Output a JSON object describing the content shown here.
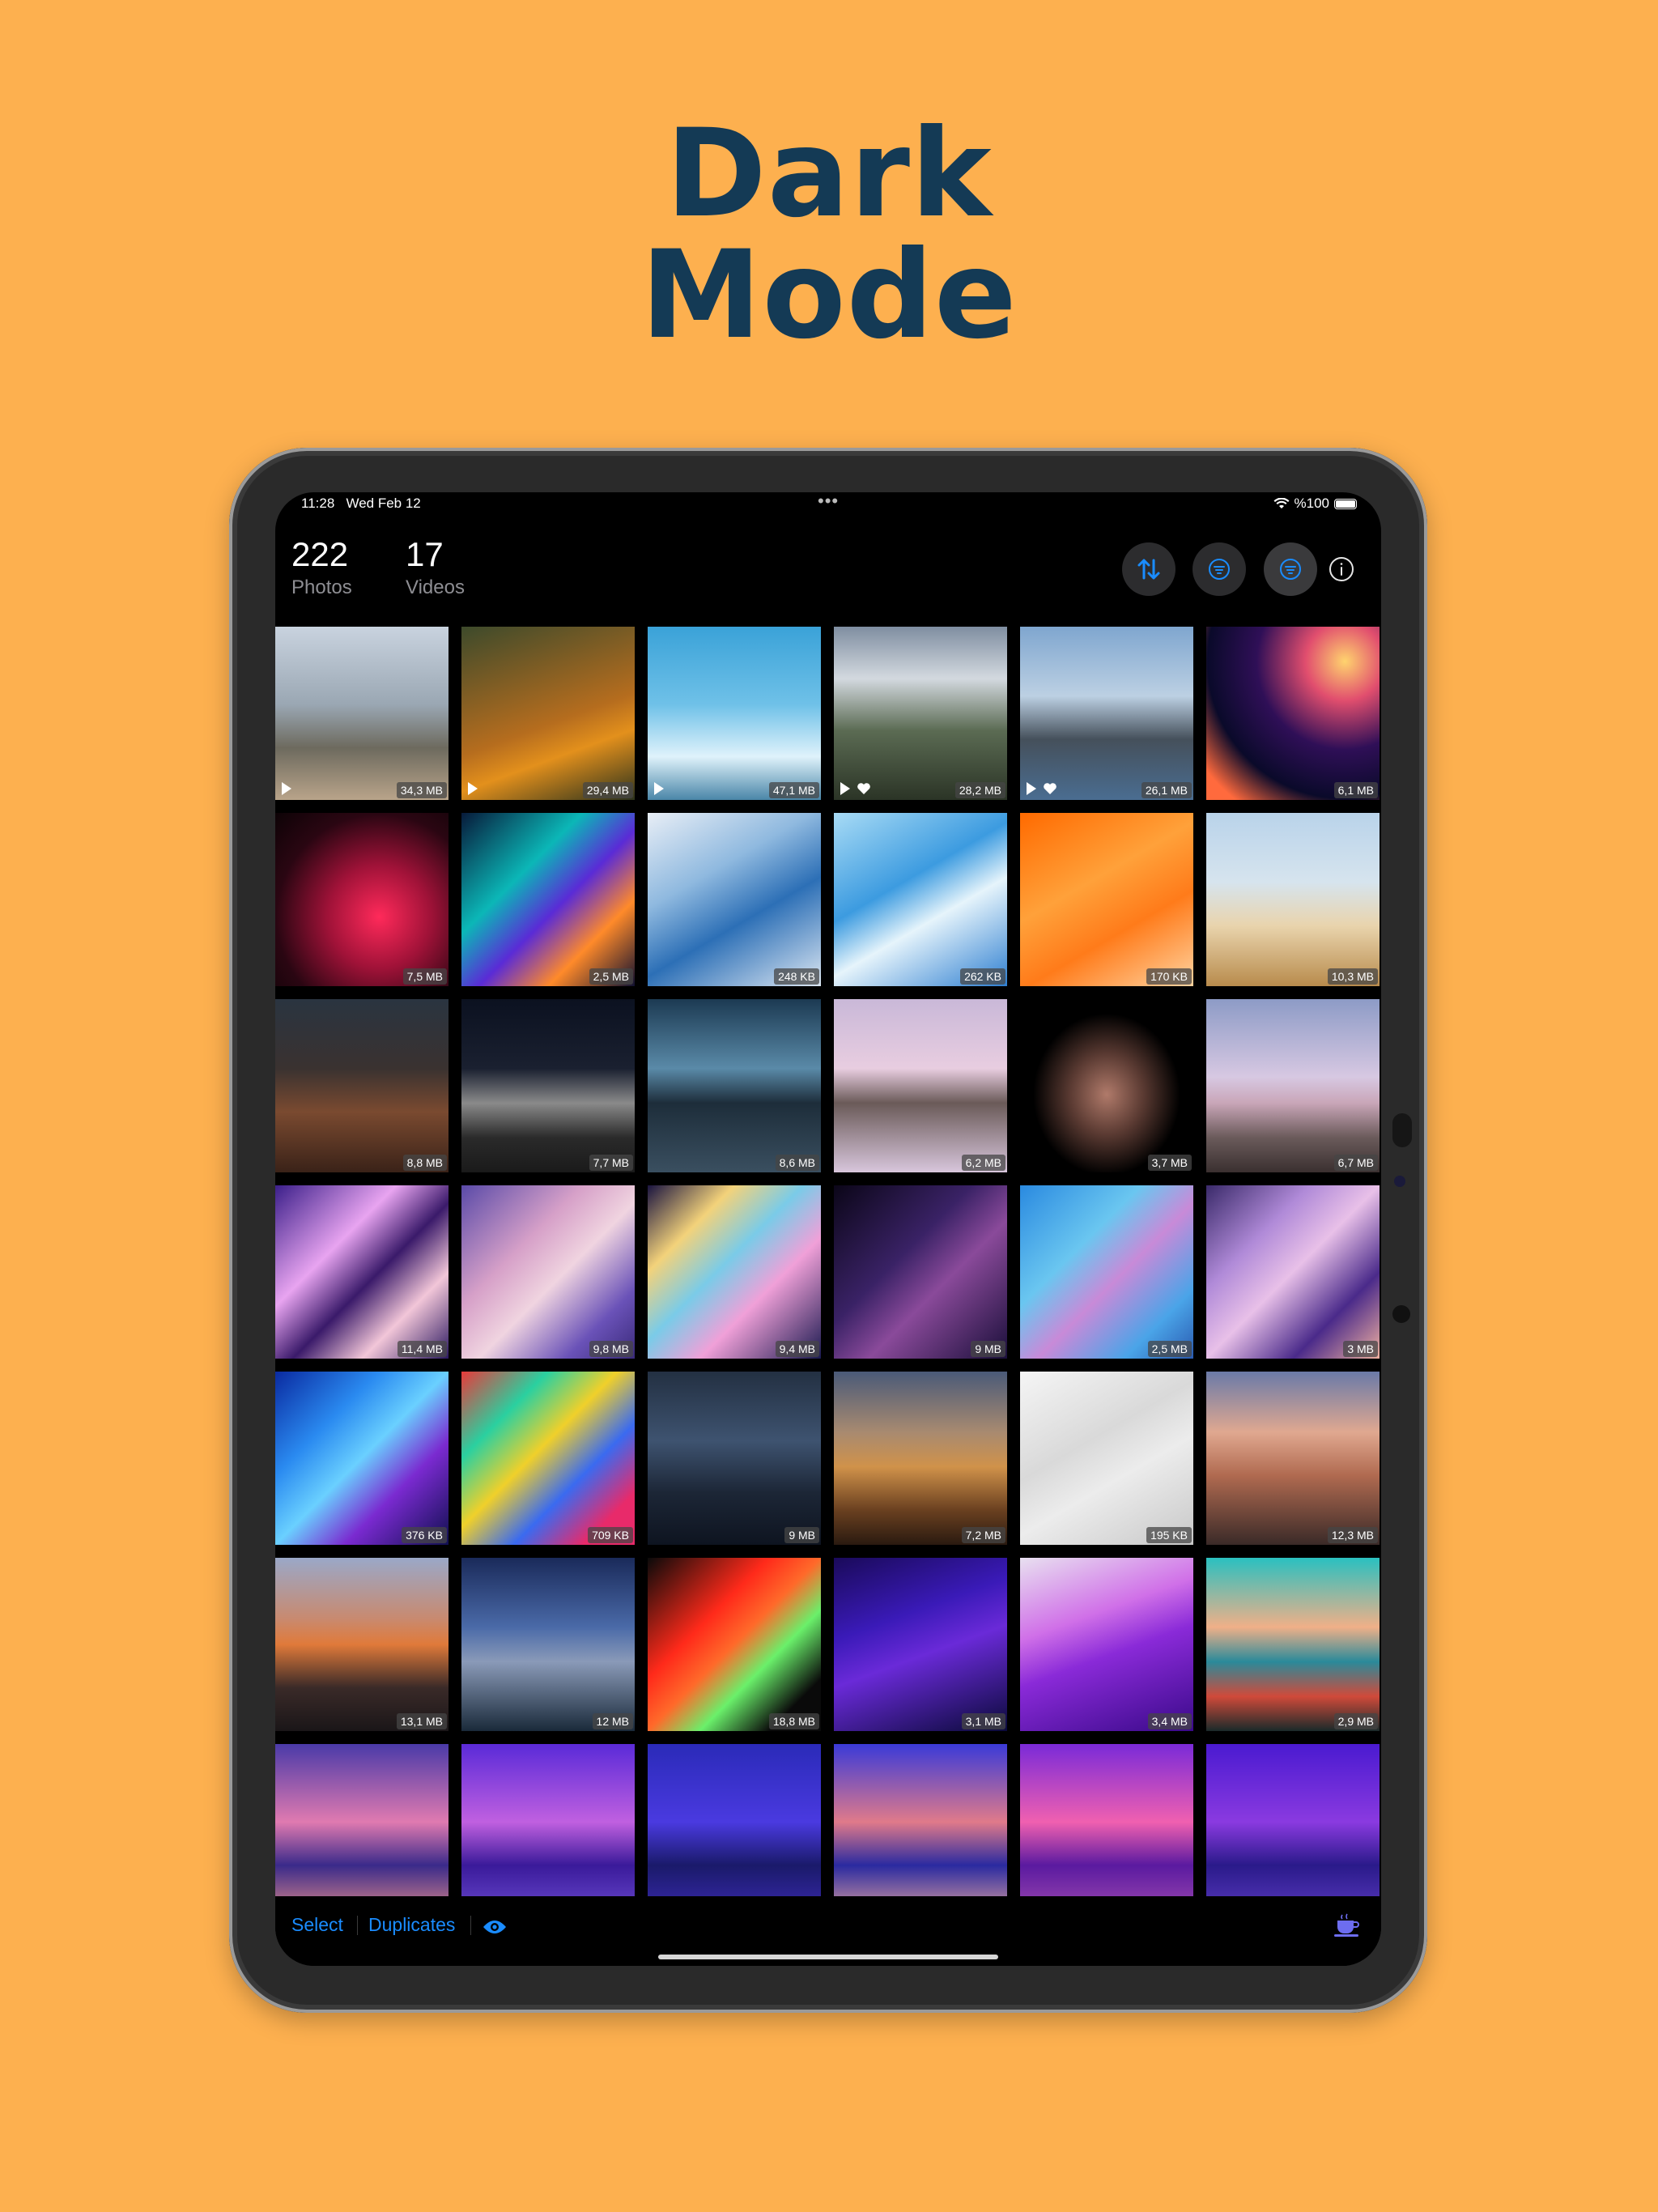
{
  "headline": {
    "line1": "Dark",
    "line2": "Mode"
  },
  "status": {
    "time": "11:28",
    "date": "Wed Feb 12",
    "battery": "%100"
  },
  "header": {
    "photos_count": "222",
    "photos_label": "Photos",
    "videos_count": "17",
    "videos_label": "Videos"
  },
  "grid": {
    "rows": [
      [
        {
          "size": "34,3 MB",
          "video": true,
          "favorite": false
        },
        {
          "size": "29,4 MB",
          "video": true,
          "favorite": false
        },
        {
          "size": "47,1 MB",
          "video": true,
          "favorite": false
        },
        {
          "size": "28,2 MB",
          "video": true,
          "favorite": true
        },
        {
          "size": "26,1 MB",
          "video": true,
          "favorite": true
        },
        {
          "size": "6,1 MB",
          "video": false,
          "favorite": false
        }
      ],
      [
        {
          "size": "7,5 MB"
        },
        {
          "size": "2,5 MB"
        },
        {
          "size": "248 KB"
        },
        {
          "size": "262 KB"
        },
        {
          "size": "170 KB"
        },
        {
          "size": "10,3 MB"
        }
      ],
      [
        {
          "size": "8,8 MB"
        },
        {
          "size": "7,7 MB"
        },
        {
          "size": "8,6 MB"
        },
        {
          "size": "6,2 MB"
        },
        {
          "size": "3,7 MB"
        },
        {
          "size": "6,7 MB"
        }
      ],
      [
        {
          "size": "11,4 MB"
        },
        {
          "size": "9,8 MB"
        },
        {
          "size": "9,4 MB"
        },
        {
          "size": "9 MB"
        },
        {
          "size": "2,5 MB"
        },
        {
          "size": "3 MB"
        }
      ],
      [
        {
          "size": "376 KB"
        },
        {
          "size": "709 KB"
        },
        {
          "size": "9 MB"
        },
        {
          "size": "7,2 MB"
        },
        {
          "size": "195 KB"
        },
        {
          "size": "12,3 MB"
        }
      ],
      [
        {
          "size": "13,1 MB"
        },
        {
          "size": "12 MB"
        },
        {
          "size": "18,8 MB"
        },
        {
          "size": "3,1 MB"
        },
        {
          "size": "3,4 MB"
        },
        {
          "size": "2,9 MB"
        }
      ],
      [
        {
          "size": ""
        },
        {
          "size": ""
        },
        {
          "size": ""
        },
        {
          "size": ""
        },
        {
          "size": ""
        },
        {
          "size": ""
        }
      ]
    ]
  },
  "toolbar": {
    "select_label": "Select",
    "duplicates_label": "Duplicates"
  },
  "icons": {
    "sort": "sort-arrows-icon",
    "filter1": "filter-icon",
    "filter2": "filter-active-icon",
    "info": "info-icon",
    "eye": "eye-icon",
    "coffee": "coffee-cup-icon"
  },
  "colors": {
    "background": "#FDB04F",
    "headline": "#143A55",
    "accent": "#1A8CFF"
  }
}
